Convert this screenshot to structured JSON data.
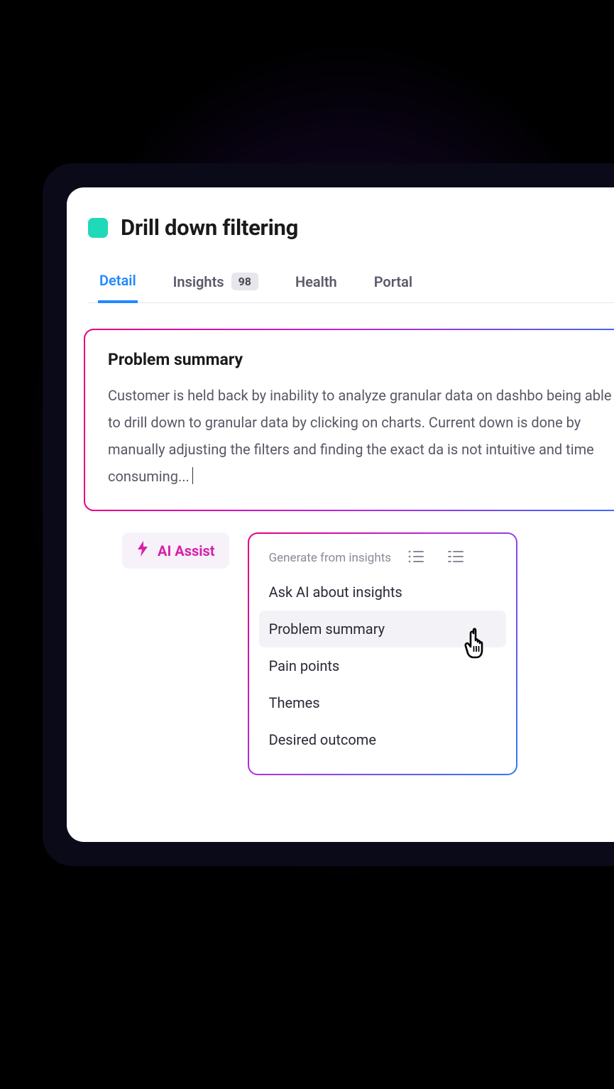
{
  "header": {
    "title": "Drill down filtering",
    "swatch_color": "#1fd9b8"
  },
  "tabs": [
    {
      "id": "detail",
      "label": "Detail",
      "active": true
    },
    {
      "id": "insights",
      "label": "Insights",
      "badge": "98"
    },
    {
      "id": "health",
      "label": "Health"
    },
    {
      "id": "portal",
      "label": "Portal"
    }
  ],
  "summary": {
    "title": "Problem summary",
    "text": "Customer is held back by inability to analyze granular data on dashbo being able to drill down to granular data by clicking on charts. Current down is done by manually adjusting the filters and finding the exact da is not intuitive and time consuming..."
  },
  "ai_assist": {
    "button_label": "AI Assist",
    "dropdown_header": "Generate from insights",
    "items": [
      {
        "id": "ask",
        "label": "Ask AI about insights",
        "hovered": false
      },
      {
        "id": "problem",
        "label": "Problem summary",
        "hovered": true
      },
      {
        "id": "pain",
        "label": "Pain points",
        "hovered": false
      },
      {
        "id": "themes",
        "label": "Themes",
        "hovered": false
      },
      {
        "id": "outcome",
        "label": "Desired outcome",
        "hovered": false
      }
    ]
  }
}
